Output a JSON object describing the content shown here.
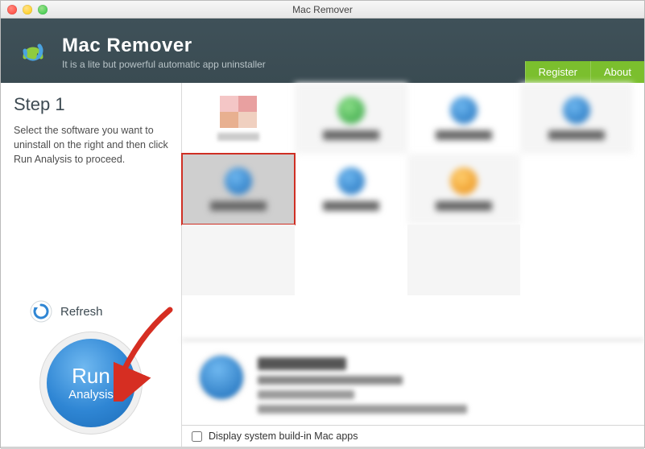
{
  "window": {
    "title": "Mac Remover"
  },
  "header": {
    "title": "Mac Remover",
    "subtitle": "It is a lite but powerful automatic app uninstaller",
    "register_label": "Register",
    "about_label": "About"
  },
  "sidebar": {
    "step_title": "Step 1",
    "step_desc": "Select the software you want to uninstall on the right and then click Run Analysis to proceed.",
    "refresh_label": "Refresh",
    "run_line1": "Run",
    "run_line2": "Analysis"
  },
  "grid": {
    "selected_index": 4,
    "items": [
      {
        "icon_color": "#f4c6c6"
      },
      {
        "icon_color": "#4caf50"
      },
      {
        "icon_color": "#2f86d4"
      },
      {
        "icon_color": "#2f86d4"
      },
      {
        "icon_color": "#2f86d4"
      },
      {
        "icon_color": "#2f86d4"
      },
      {
        "icon_color": "#ff9800"
      },
      {
        "icon_color": ""
      }
    ]
  },
  "footer": {
    "checkbox_label": "Display system build-in Mac apps",
    "checked": false
  },
  "colors": {
    "header_bg": "#3a4b52",
    "accent_green": "#7bbf2e",
    "run_blue": "#2f86d4",
    "selection_red": "#cf2f24",
    "arrow_red": "#d62e22"
  }
}
